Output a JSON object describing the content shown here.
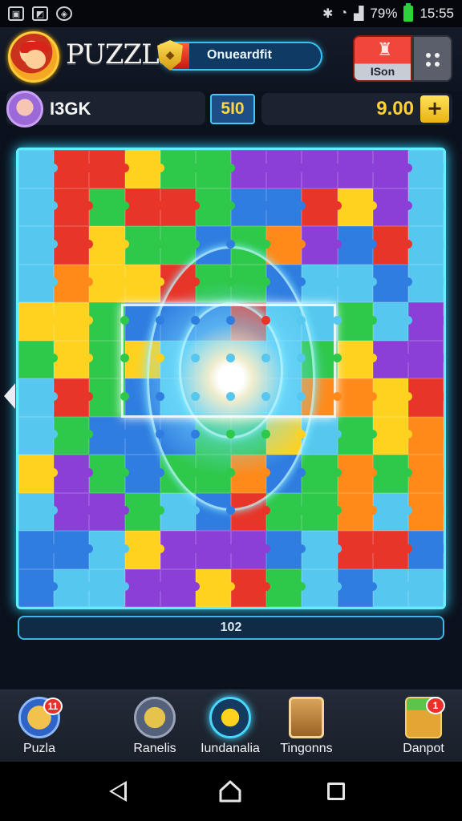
{
  "status_bar": {
    "icons_left": [
      "image-icon",
      "gallery-icon",
      "compass-icon"
    ],
    "icons_right": [
      "bluetooth-icon",
      "wifi-icon",
      "signal-icon"
    ],
    "battery_text": "79%",
    "time": "15:55"
  },
  "header": {
    "app_title": "PUZZLE",
    "progress_label": "Onueardfit",
    "progress_fraction": 0.17,
    "mode_button_label": "ISon",
    "menu_icon": "grid-dots-icon"
  },
  "player": {
    "name": "I3GK",
    "level": "5I0",
    "coins": "9.00",
    "add_coins_icon": "plus-icon"
  },
  "board": {
    "rows": 12,
    "cols": 12,
    "colors": [
      "#e8352a",
      "#ffd21f",
      "#2ec84a",
      "#2f7de0",
      "#8b3fd6",
      "#ff8a1a",
      "#56c8f0"
    ]
  },
  "counter_text": "102",
  "bottom_nav": [
    {
      "label": "Puzla",
      "icon": "puzzle-shop-icon",
      "badge": "11"
    },
    {
      "label": "Ranelis",
      "icon": "rocket-icon",
      "badge": ""
    },
    {
      "label": "Iundanalia",
      "icon": "music-note-icon",
      "badge": ""
    },
    {
      "label": "Tingonns",
      "icon": "door-icon",
      "badge": ""
    },
    {
      "label": "Danpot",
      "icon": "gift-box-icon",
      "badge": "1"
    }
  ],
  "system_nav": [
    "back-icon",
    "home-icon",
    "recents-icon"
  ],
  "colors": {
    "accent_cyan": "#5ef0ff",
    "coin_yellow": "#ffd23a",
    "alert_red": "#e8302a"
  }
}
